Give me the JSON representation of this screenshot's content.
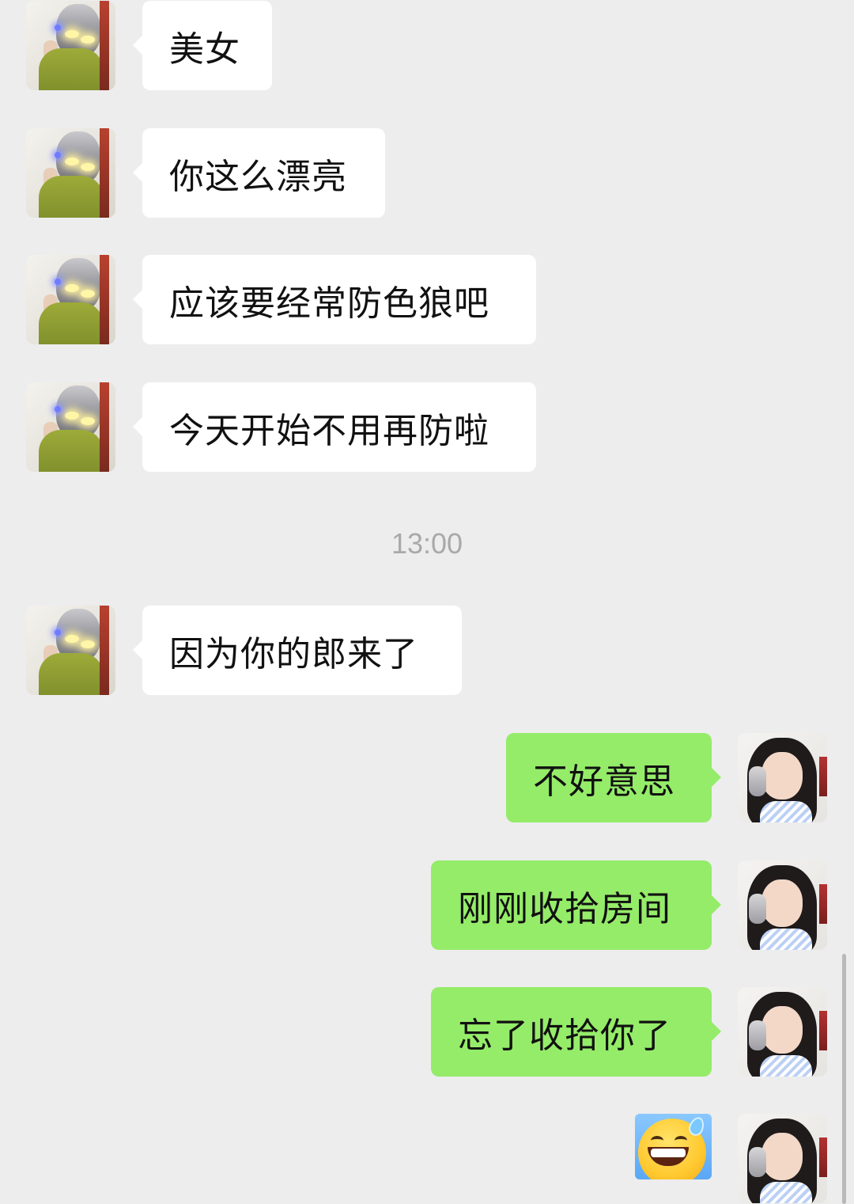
{
  "conversation": {
    "messages": [
      {
        "id": 1,
        "sender": "other",
        "text": "美女"
      },
      {
        "id": 2,
        "sender": "other",
        "text": "你这么漂亮"
      },
      {
        "id": 3,
        "sender": "other",
        "text": "应该要经常防色狼吧"
      },
      {
        "id": 4,
        "sender": "other",
        "text": "今天开始不用再防啦"
      },
      {
        "id": 5,
        "sender": "other",
        "text": "因为你的郎来了"
      },
      {
        "id": 6,
        "sender": "self",
        "text": "不好意思"
      },
      {
        "id": 7,
        "sender": "self",
        "text": "刚刚收拾房间"
      },
      {
        "id": 8,
        "sender": "self",
        "text": "忘了收拾你了"
      },
      {
        "id": 9,
        "sender": "self",
        "type": "emoji",
        "icon": "grinning-sweat-emoji"
      }
    ],
    "timestamp": "13:00"
  },
  "theme": {
    "background": "#ededed",
    "incoming_bubble": "#ffffff",
    "outgoing_bubble": "#95ec69",
    "timestamp_color": "#a9a9a9"
  }
}
